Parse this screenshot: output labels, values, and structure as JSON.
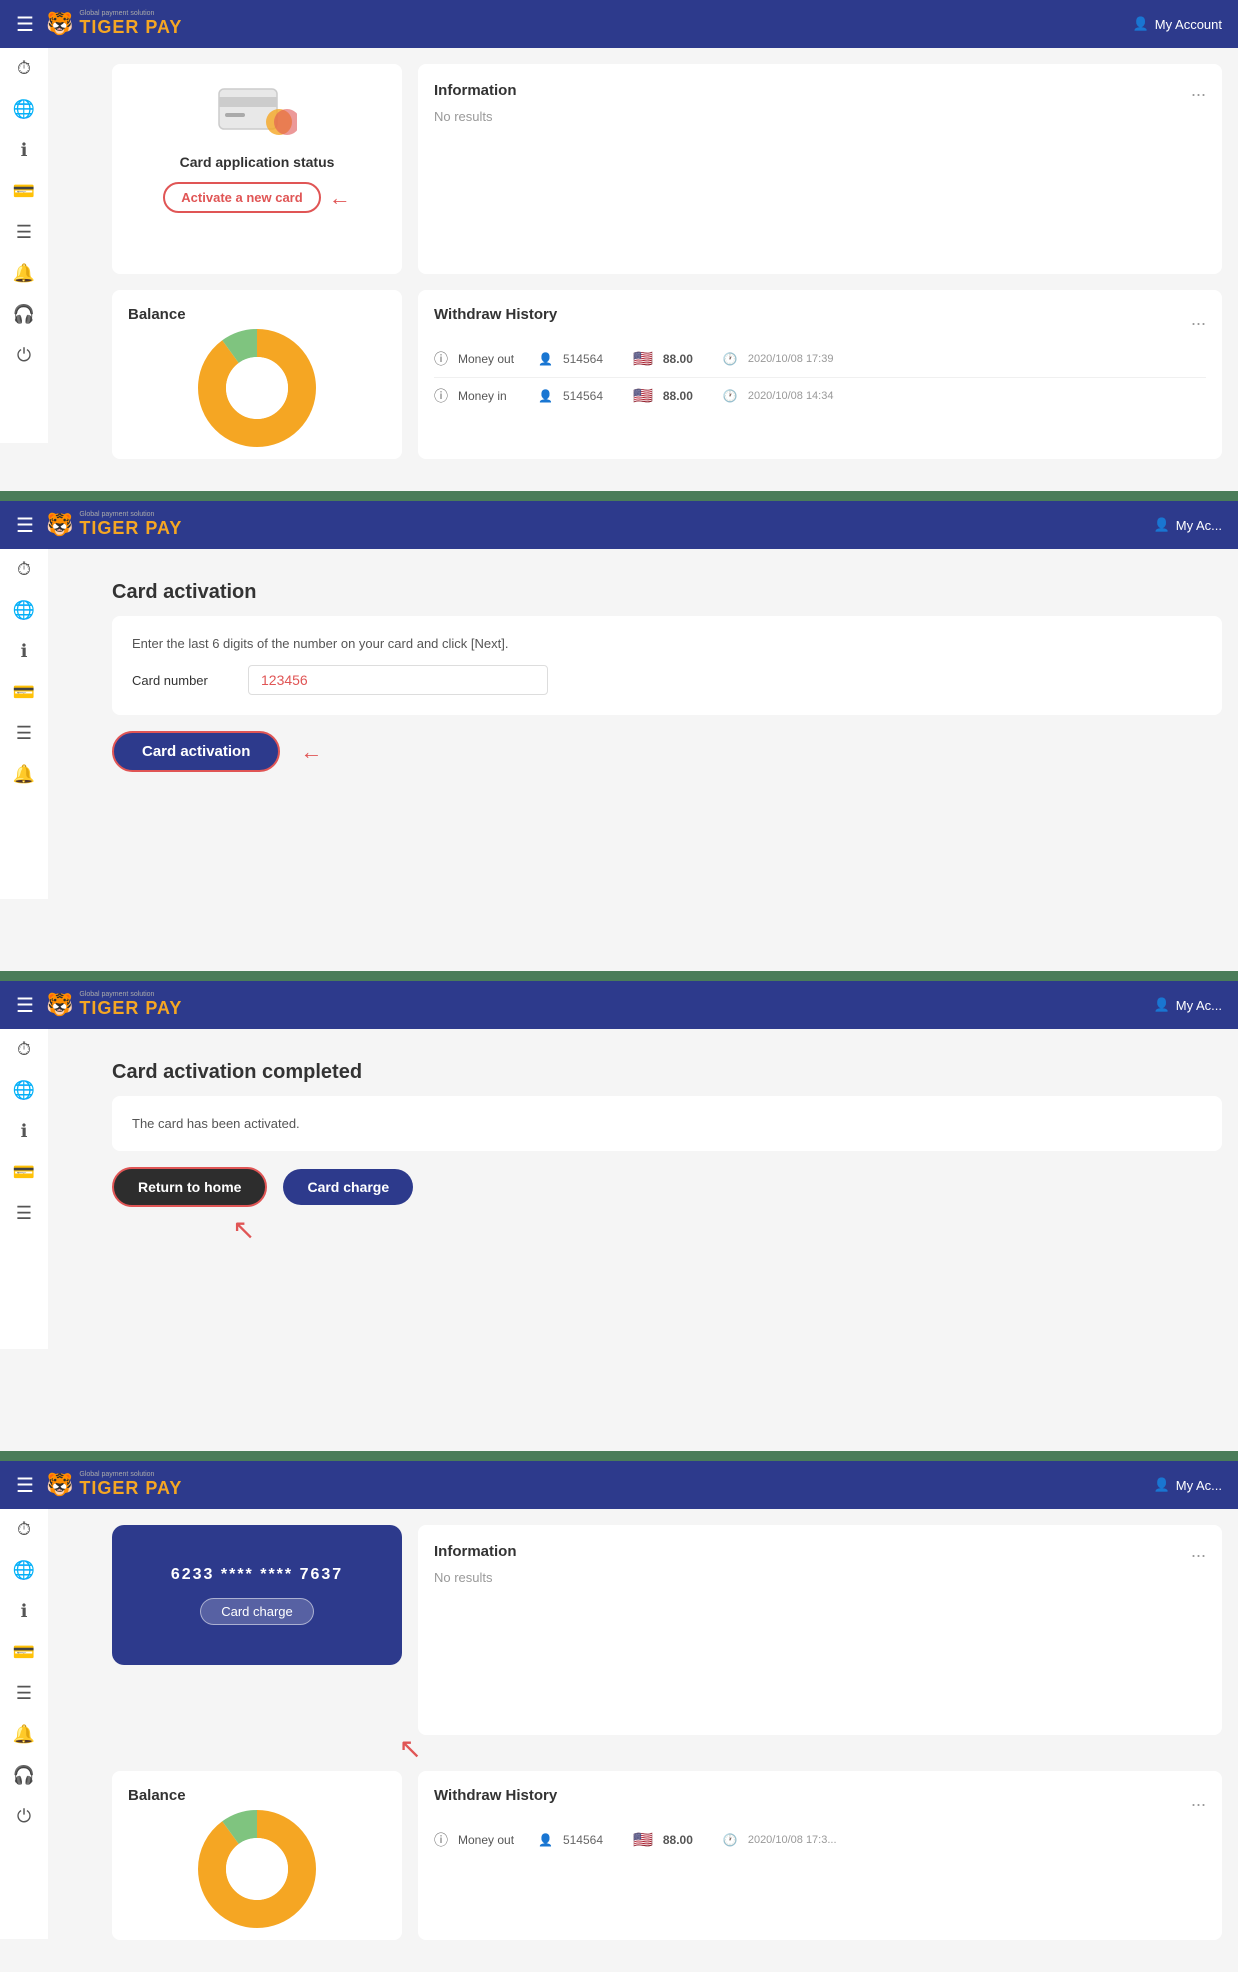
{
  "brand": {
    "name": "TIGER PAY",
    "sub": "Global payment solution",
    "logo_emoji": "🐯"
  },
  "header": {
    "my_account": "My Account"
  },
  "sidebar": {
    "icons": [
      {
        "name": "clock-icon",
        "glyph": "⏱"
      },
      {
        "name": "globe-icon",
        "glyph": "🌐"
      },
      {
        "name": "info-icon",
        "glyph": "ℹ"
      },
      {
        "name": "card-icon",
        "glyph": "💳"
      },
      {
        "name": "list-icon",
        "glyph": "☰"
      },
      {
        "name": "bell-icon",
        "glyph": "🔔"
      },
      {
        "name": "headset-icon",
        "glyph": "🎧"
      },
      {
        "name": "power-icon",
        "glyph": "⏻"
      }
    ]
  },
  "screen1": {
    "card_panel": {
      "title": "Card application status",
      "activate_btn": "Activate a new card"
    },
    "info_panel": {
      "title": "Information",
      "no_results": "No results",
      "dots": "..."
    },
    "balance_panel": {
      "title": "Balance"
    },
    "withdraw_panel": {
      "title": "Withdraw History",
      "dots": "...",
      "rows": [
        {
          "type": "Money out",
          "id": "514564",
          "amount": "88.00",
          "date": "2020/10/08 17:39"
        },
        {
          "type": "Money in",
          "id": "514564",
          "amount": "88.00",
          "date": "2020/10/08 14:34"
        }
      ]
    }
  },
  "screen2": {
    "page_title": "Card activation",
    "form_instruction": "Enter the last 6 digits of the number on your card and click [Next].",
    "card_number_label": "Card number",
    "card_number_value": "123456",
    "activate_button": "Card activation"
  },
  "screen3": {
    "page_title": "Card activation completed",
    "message": "The card has been activated.",
    "return_home_btn": "Return to home",
    "card_charge_btn": "Card charge"
  },
  "screen4": {
    "card_number_display": "6233 **** **** 7637",
    "card_charge_label": "Card charge",
    "info_panel": {
      "title": "Information",
      "no_results": "No results",
      "dots": "..."
    },
    "balance_panel": {
      "title": "Balance"
    },
    "withdraw_panel": {
      "title": "Withdraw History",
      "dots": "...",
      "rows": [
        {
          "type": "Money out",
          "id": "514564",
          "amount": "88.00",
          "date": "2020/10/08 17:3"
        }
      ]
    }
  }
}
